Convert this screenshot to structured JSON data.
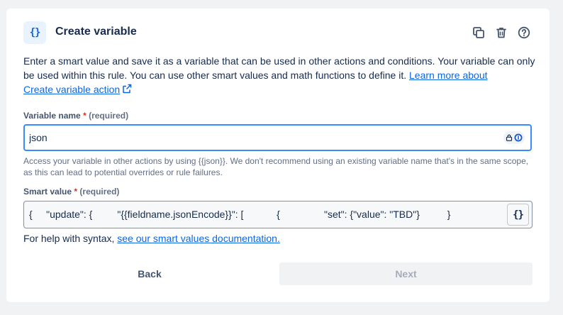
{
  "header": {
    "icon_text": "{}",
    "title": "Create variable"
  },
  "description": {
    "text": "Enter a smart value and save it as a variable that can be used in other actions and conditions. Your variable can only be used within this rule. You can use other smart values and math functions to define it. ",
    "link_line1": "Learn more about",
    "link_line2": "Create variable action"
  },
  "variable_name": {
    "label": "Variable name",
    "required_mark": "*",
    "required_text": "(required)",
    "value": "json",
    "help": "Access your variable in other actions by using {{json}}. We don't recommend using an existing variable name that's in the same scope, as this can lead to potential overrides or rule failures."
  },
  "smart_value": {
    "label": "Smart value",
    "required_mark": "*",
    "required_text": "(required)",
    "value": "{     \"update\": {         \"{{fieldname.jsonEncode}}\": [            {                \"set\": {\"value\": \"TBD\"}          }",
    "button_text": "{}"
  },
  "syntax_help": {
    "text": "For help with syntax, ",
    "link": "see our smart values documentation."
  },
  "buttons": {
    "back": "Back",
    "next": "Next"
  },
  "colors": {
    "accent": "#0c66e4",
    "focus_border": "#388bff",
    "required": "#c9372c",
    "disabled_bg": "#f1f2f4"
  }
}
